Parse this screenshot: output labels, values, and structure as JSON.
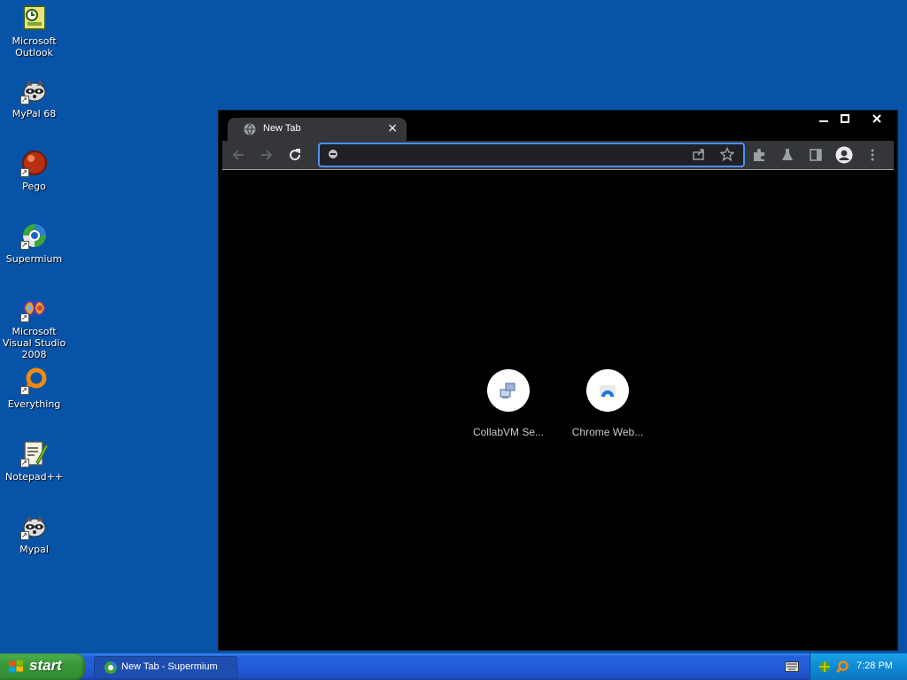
{
  "desktop": {
    "icons": [
      {
        "label": "Microsoft Outlook",
        "name": "outlook-desktop-icon"
      },
      {
        "label": "MyPal 68",
        "name": "mypal68-desktop-icon"
      },
      {
        "label": "Pego",
        "name": "pego-desktop-icon"
      },
      {
        "label": "Supermium",
        "name": "supermium-desktop-icon"
      },
      {
        "label": "Microsoft Visual Studio 2008",
        "name": "visual-studio-desktop-icon"
      },
      {
        "label": "Everything",
        "name": "everything-desktop-icon"
      },
      {
        "label": "Notepad++",
        "name": "notepadpp-desktop-icon"
      },
      {
        "label": "Mypal",
        "name": "mypal-desktop-icon"
      }
    ]
  },
  "browser": {
    "tab": {
      "title": "New Tab",
      "close": "×"
    },
    "omnibox": {
      "value": "",
      "placeholder": ""
    },
    "shortcuts": [
      {
        "label": "CollabVM Se...",
        "icon": "collabvm-icon"
      },
      {
        "label": "Chrome Web...",
        "icon": "chrome-web-store-icon"
      }
    ]
  },
  "taskbar": {
    "start_label": "start",
    "task": "New Tab - Supermium",
    "clock": "7:28 PM"
  },
  "colors": {
    "desktop": "#0653a7",
    "browser_bg": "#000000",
    "toolbar": "#35363a",
    "omnibox_border": "#4d90fe",
    "taskbar": "#245ddb",
    "start": "#3a9a3a",
    "tray": "#0f8ad5"
  }
}
